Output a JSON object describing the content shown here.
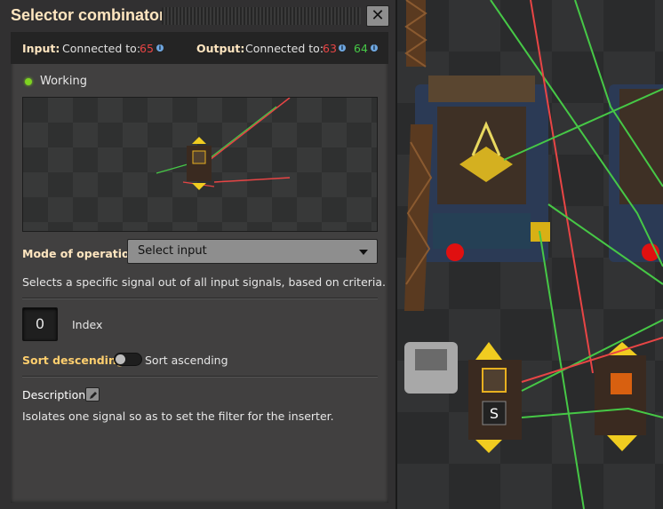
{
  "window": {
    "title": "Selector combinator",
    "close_glyph": "✕"
  },
  "connections": {
    "input_label": "Input:",
    "input_connected_text": "Connected to:",
    "input_red": "65",
    "output_label": "Output:",
    "output_connected_text": "Connected to:",
    "output_red": "63",
    "output_green": "64"
  },
  "status": {
    "text": "Working",
    "color": "#7ed321"
  },
  "mode": {
    "label": "Mode of operation",
    "selected": "Select input",
    "description": "Selects a specific signal out of all input signals, based on criteria."
  },
  "index": {
    "value": "0",
    "label": "Index"
  },
  "sort": {
    "descending_label": "Sort descending",
    "ascending_label": "Sort ascending",
    "state": "descending"
  },
  "description": {
    "heading": "Description",
    "text": "Isolates one signal so as to set the filter for the inserter."
  },
  "world": {
    "combinator_signal_glyph": "S"
  },
  "colors": {
    "title": "#ffe6c0",
    "red_wire": "#e84545",
    "green_wire": "#46c846",
    "accent_label": "#ffcf6e"
  },
  "icons": [
    "close-icon",
    "info-icon",
    "status-dot-icon",
    "chevron-down-icon",
    "pencil-icon"
  ]
}
